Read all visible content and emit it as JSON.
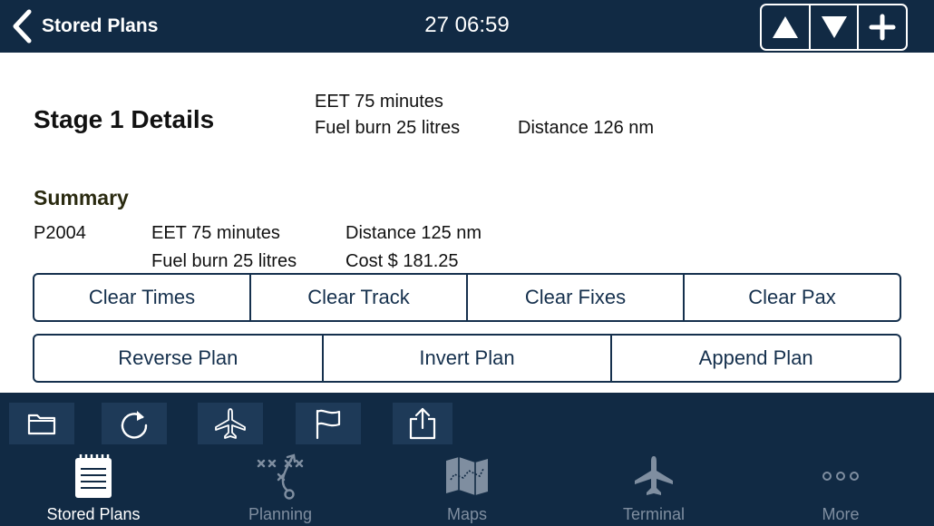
{
  "header": {
    "back_label": "Stored Plans",
    "time": "27 06:59",
    "buttons": [
      "move-up",
      "move-down",
      "add"
    ]
  },
  "stage": {
    "title": "Stage 1 Details",
    "eet": "EET 75 minutes",
    "fuel": "Fuel burn 25 litres",
    "distance": "Distance 126 nm"
  },
  "summary": {
    "title": "Summary",
    "plan_id": "P2004",
    "eet": "EET 75 minutes",
    "fuel": "Fuel burn 25 litres",
    "distance": "Distance 125 nm",
    "cost": "Cost $ 181.25"
  },
  "actions_row1": [
    "Clear Times",
    "Clear Track",
    "Clear Fixes",
    "Clear Pax"
  ],
  "actions_row2": [
    "Reverse Plan",
    "Invert Plan",
    "Append Plan"
  ],
  "toolbar": {
    "icons": [
      "folder-icon",
      "refresh-icon",
      "airplane-icon",
      "flag-icon",
      "share-icon"
    ]
  },
  "tabs": [
    {
      "label": "Stored Plans",
      "icon": "notepad-icon",
      "active": true
    },
    {
      "label": "Planning",
      "icon": "play-diagram-icon",
      "active": false
    },
    {
      "label": "Maps",
      "icon": "map-icon",
      "active": false
    },
    {
      "label": "Terminal",
      "icon": "airplane-icon",
      "active": false
    },
    {
      "label": "More",
      "icon": "more-dots-icon",
      "active": false
    }
  ],
  "colors": {
    "navbar_bg": "#112a44",
    "button_border": "#15304d",
    "tab_inactive": "#7f8ea0",
    "tab_active": "#ffffff"
  }
}
